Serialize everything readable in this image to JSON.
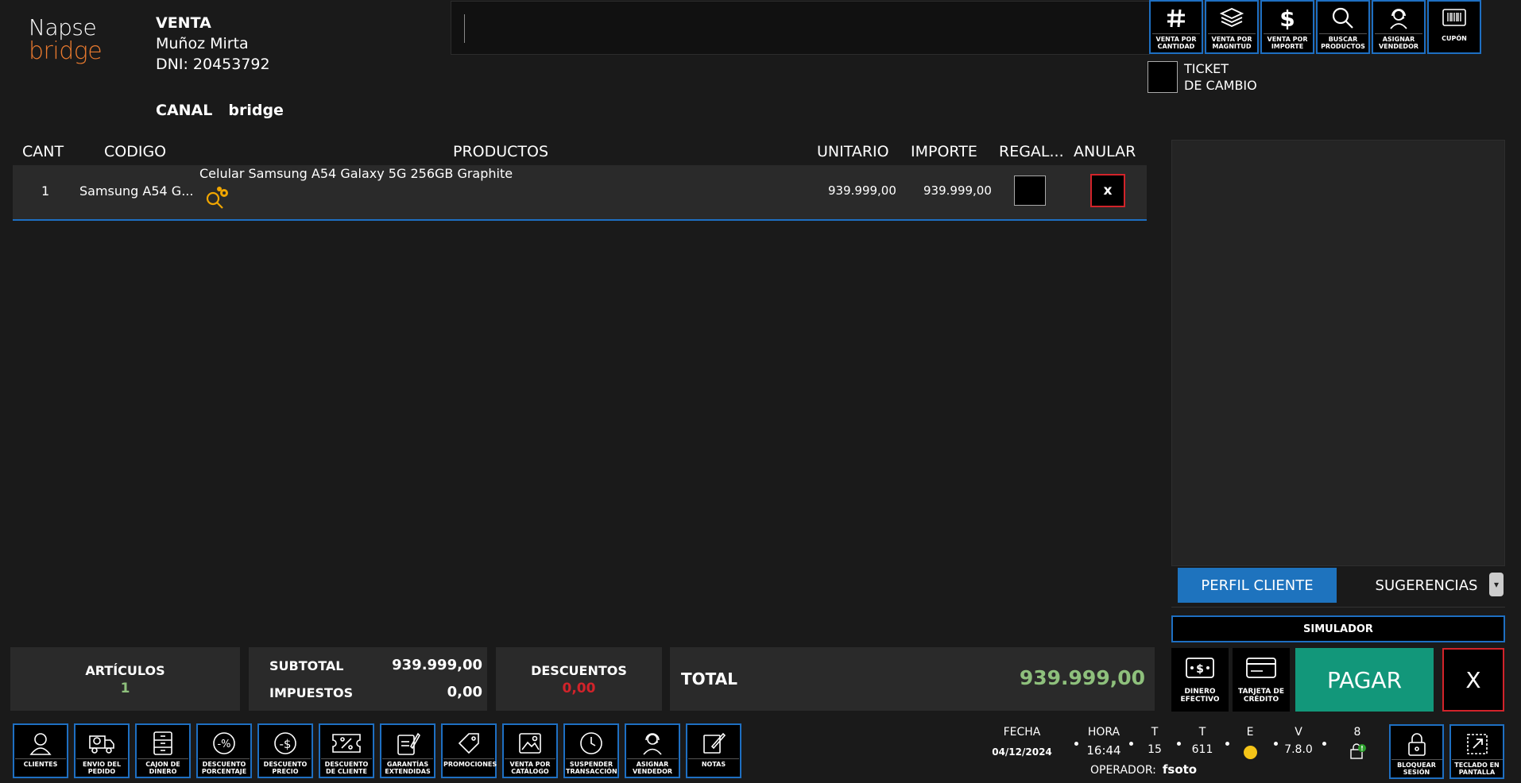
{
  "logo": {
    "line1": "Napse",
    "line2": "bridge"
  },
  "customer": {
    "title": "VENTA",
    "name": "Muñoz Mirta",
    "dni": "DNI: 20453792"
  },
  "canal": {
    "label": "CANAL",
    "value": "bridge"
  },
  "search": {
    "value": "",
    "placeholder": ""
  },
  "top_buttons": [
    {
      "icon": "hash-icon",
      "label": "VENTA POR CANTIDAD"
    },
    {
      "icon": "layers-icon",
      "label": "VENTA POR MAGNITUD"
    },
    {
      "icon": "dollar-icon",
      "label": "VENTA POR IMPORTE"
    },
    {
      "icon": "search-icon",
      "label": "BUSCAR PRODUCTOS"
    },
    {
      "icon": "headset-icon",
      "label": "ASIGNAR VENDEDOR"
    },
    {
      "icon": "barcode-icon",
      "label": "CUPÓN"
    }
  ],
  "ticket": {
    "line1": "TICKET",
    "line2": "DE CAMBIO"
  },
  "table": {
    "headers": {
      "cant": "CANT",
      "codigo": "CODIGO",
      "productos": "PRODUCTOS",
      "unitario": "UNITARIO",
      "importe": "IMPORTE",
      "regalo": "REGAL...",
      "anular": "ANULAR"
    },
    "rows": [
      {
        "cant": "1",
        "codigo": "Samsung A54 G...",
        "producto": "Celular Samsung A54 Galaxy 5G 256GB Graphite",
        "unitario": "939.999,00",
        "importe": "939.999,00",
        "anular": "x"
      }
    ]
  },
  "tabs": {
    "perfil": "PERFIL CLIENTE",
    "sugerencias": "SUGERENCIAS"
  },
  "simulador": "SIMULADOR",
  "payment": {
    "dinero_efectivo": "DINERO EFECTIVO",
    "tarjeta_credito": "TARJETA DE CRÉDITO",
    "pagar": "PAGAR",
    "cancel": "X"
  },
  "summary": {
    "articulos_label": "ARTÍCULOS",
    "articulos_value": "1",
    "subtotal_label": "SUBTOTAL",
    "subtotal_value": "939.999,00",
    "impuestos_label": "IMPUESTOS",
    "impuestos_value": "0,00",
    "descuentos_label": "DESCUENTOS",
    "descuentos_value": "0,00",
    "total_label": "TOTAL",
    "total_value": "939.999,00"
  },
  "bottom_buttons": [
    {
      "icon": "user-icon",
      "label": "CLIENTES"
    },
    {
      "icon": "truck-icon",
      "label": "ENVIO DEL PEDIDO"
    },
    {
      "icon": "cash-drawer-icon",
      "label": "CAJON DE DINERO"
    },
    {
      "icon": "percent-discount-icon",
      "label": "DESCUENTO PORCENTAJE"
    },
    {
      "icon": "price-discount-icon",
      "label": "DESCUENTO PRECIO"
    },
    {
      "icon": "coupon-percent-icon",
      "label": "DESCUENTO DE CLIENTE"
    },
    {
      "icon": "warranty-edit-icon",
      "label": "GARANTÍAS EXTENDIDAS"
    },
    {
      "icon": "tag-icon",
      "label": "PROMOCIONES"
    },
    {
      "icon": "catalog-icon",
      "label": "VENTA POR CATÁLOGO"
    },
    {
      "icon": "clock-icon",
      "label": "SUSPENDER TRANSACCIÓN"
    },
    {
      "icon": "headset-icon",
      "label": "ASIGNAR VENDEDOR"
    },
    {
      "icon": "notes-icon",
      "label": "NOTAS"
    }
  ],
  "status": {
    "fecha_label": "FECHA",
    "fecha_value": "04/12/2024",
    "hora_label": "HORA",
    "hora_value": "16:44",
    "t1_label": "T",
    "t1_value": "15",
    "t2_label": "T",
    "t2_value": "611",
    "e_label": "E",
    "v_label": "V",
    "v_value": "7.8.0",
    "n_label": "8",
    "operador_label": "OPERADOR:",
    "operador_value": "fsoto"
  },
  "session_buttons": [
    {
      "icon": "lock-icon",
      "label": "BLOQUEAR SESIÓN"
    },
    {
      "icon": "expand-keyboard-icon",
      "label": "TECLADO EN PANTALLA"
    }
  ],
  "colors": {
    "accent": "#1e6fc2",
    "danger": "#d2232a",
    "success": "#12977a",
    "amount": "#8ec07c",
    "brand": "#e8792e",
    "status_dot": "#f5c518"
  }
}
